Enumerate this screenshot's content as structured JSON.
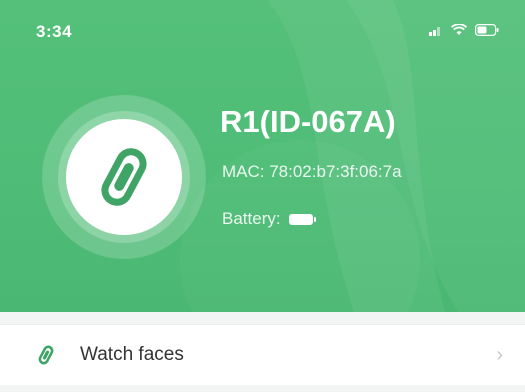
{
  "status_bar": {
    "time": "3:34",
    "icons": [
      "signal-icon",
      "wifi-icon",
      "battery-icon"
    ]
  },
  "device": {
    "name": "R1(ID-067A)",
    "mac": "MAC: 78:02:b7:3f:06:7a",
    "battery_label": "Battery:",
    "icon": "band-icon"
  },
  "menu": {
    "items": [
      {
        "label": "Watch faces",
        "icon": "band-icon",
        "chevron": "›"
      }
    ]
  },
  "colors": {
    "header_green": "#50bd77",
    "accent_green": "#3fa466",
    "text_dark": "#333333",
    "chevron_gray": "#c8c8c8"
  }
}
